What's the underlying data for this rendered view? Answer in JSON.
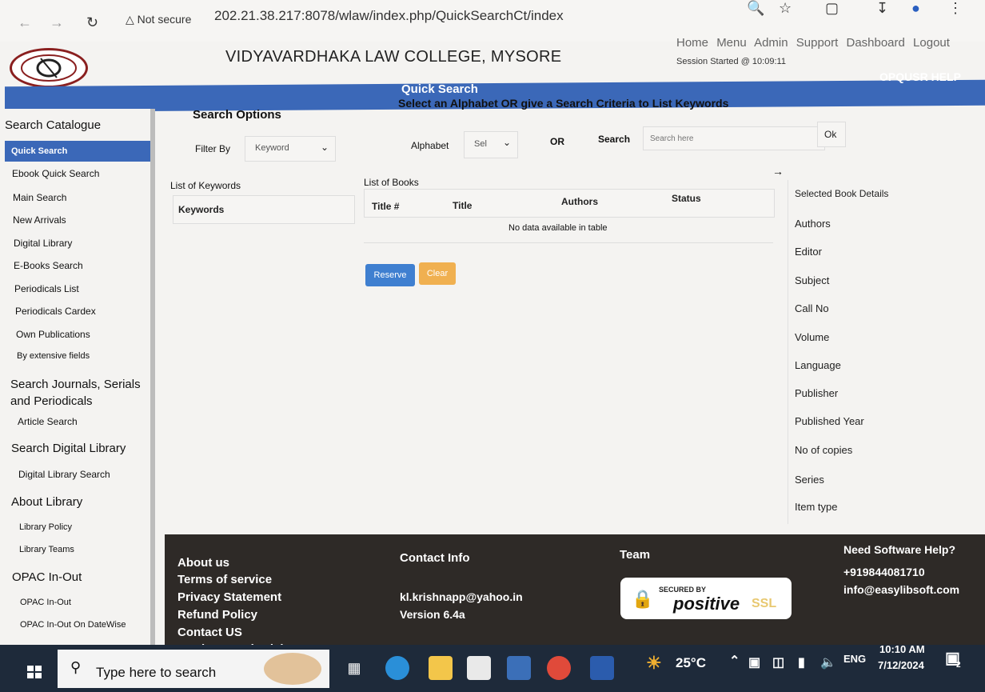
{
  "browser": {
    "back_icon": "back-arrow-icon",
    "forward_icon": "forward-arrow-icon",
    "reload_icon": "reload-icon",
    "secure_label": "Not secure",
    "url": "202.21.38.217:8078/wlaw/index.php/QuickSearchCt/index"
  },
  "header": {
    "college_name": "VIDYAVARDHAKA LAW COLLEGE, MYSORE",
    "nav": [
      "Home",
      "Menu",
      "Admin",
      "Support",
      "Dashboard",
      "Logout"
    ],
    "session": "Session Started @ 10:09:11",
    "bar_title": "Quick Search",
    "help_link": "OPQUSR HELP"
  },
  "sidebar": {
    "sections": [
      {
        "heading": "Search Catalogue",
        "items": [
          "Quick Search",
          "Ebook Quick Search",
          "Main Search",
          "New Arrivals",
          "Digital Library",
          "E-Books Search",
          "Periodicals List",
          "Periodicals Cardex",
          "Own Publications",
          "By extensive fields"
        ]
      },
      {
        "heading": "Search Journals, Serials and Periodicals",
        "items": [
          "Article Search"
        ]
      },
      {
        "heading": "Search Digital Library",
        "items": [
          "Digital Library Search"
        ]
      },
      {
        "heading": "About Library",
        "items": [
          "Library Policy",
          "Library Teams"
        ]
      },
      {
        "heading": "OPAC In-Out",
        "items": [
          "OPAC In-Out",
          "OPAC In-Out On DateWise"
        ]
      }
    ],
    "active_item": "Quick Search"
  },
  "main": {
    "search_options": "Search Options",
    "instruction": "Select an Alphabet OR give a Search Criteria to List Keywords",
    "filter_by_label": "Filter By",
    "filter_by_value": "Keyword",
    "alphabet_label": "Alphabet",
    "alphabet_value": "Sel",
    "or_label": "OR",
    "search_label": "Search",
    "search_placeholder": "Search here",
    "ok_label": "Ok",
    "arrow": "→",
    "list_keywords_title": "List of Keywords",
    "keywords_header": "Keywords",
    "list_books_title": "List of Books",
    "books_columns": [
      "Title #",
      "Title",
      "Authors",
      "Status"
    ],
    "empty_message": "No data available in table",
    "reserve_label": "Reserve",
    "clear_label": "Clear"
  },
  "details": {
    "title": "Selected Book Details",
    "fields": [
      "Authors",
      "Editor",
      "Subject",
      "Call No",
      "Volume",
      "Language",
      "Publisher",
      "Published Year",
      "No of copies",
      "Series",
      "Item type"
    ]
  },
  "footer": {
    "links": [
      "About us",
      "Terms of service",
      "Privacy Statement",
      "Refund Policy",
      "Contact US",
      "Products and Pricing"
    ],
    "contact_title": "Contact Info",
    "email": "kl.krishnapp@yahoo.in",
    "version": "Version 6.4a",
    "team_label": "Team",
    "ssl_secured": "SECURED BY",
    "ssl_brand": "positive",
    "ssl_suffix": "SSL",
    "help_title": "Need Software Help?",
    "help_phone": "+919844081710",
    "help_email": "info@easylibsoft.com"
  },
  "taskbar": {
    "search_placeholder": "Type here to search",
    "temperature": "25°C",
    "language": "ENG",
    "time": "10:10 AM",
    "date": "7/12/2024",
    "notification_count": "2"
  }
}
